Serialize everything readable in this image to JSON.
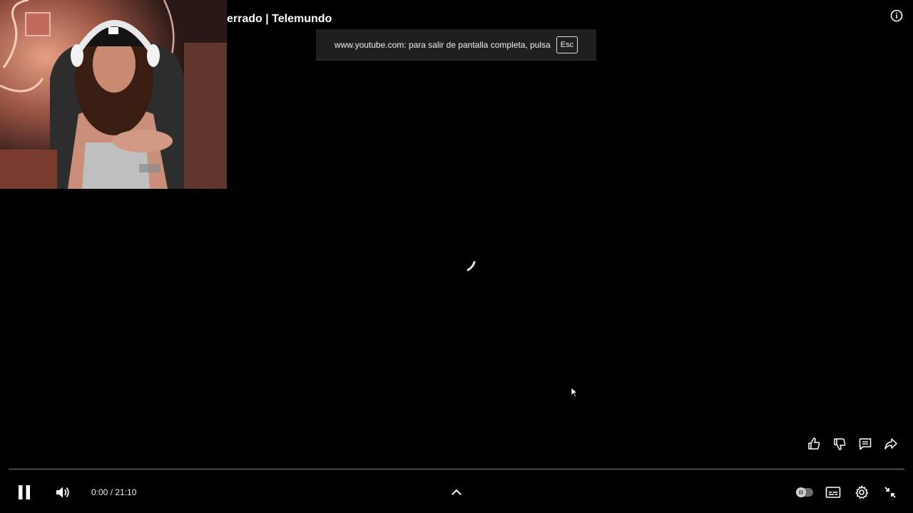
{
  "video": {
    "title": "errado | Telemundo"
  },
  "fullscreen_toast": {
    "message": "www.youtube.com: para salir de pantalla completa, pulsa",
    "key": "Esc"
  },
  "player": {
    "current_time": "0:00",
    "duration": "21:10",
    "time_display": "0:00 / 21:10",
    "progress": 0.0,
    "state": "playing",
    "loading": true
  },
  "icons": {
    "info": "info-icon",
    "like": "thumbs-up-icon",
    "dislike": "thumbs-down-icon",
    "comments": "comments-icon",
    "share": "share-icon",
    "pause": "pause-icon",
    "volume": "volume-icon",
    "expand": "chevron-up-icon",
    "autoplay": "autoplay-toggle-icon",
    "subtitles": "subtitles-icon",
    "settings": "gear-icon",
    "exit_fullscreen": "exit-fullscreen-icon"
  },
  "colors": {
    "background": "#000000",
    "progress_played": "#ff0000",
    "toast_background": "#1f1f1f"
  }
}
